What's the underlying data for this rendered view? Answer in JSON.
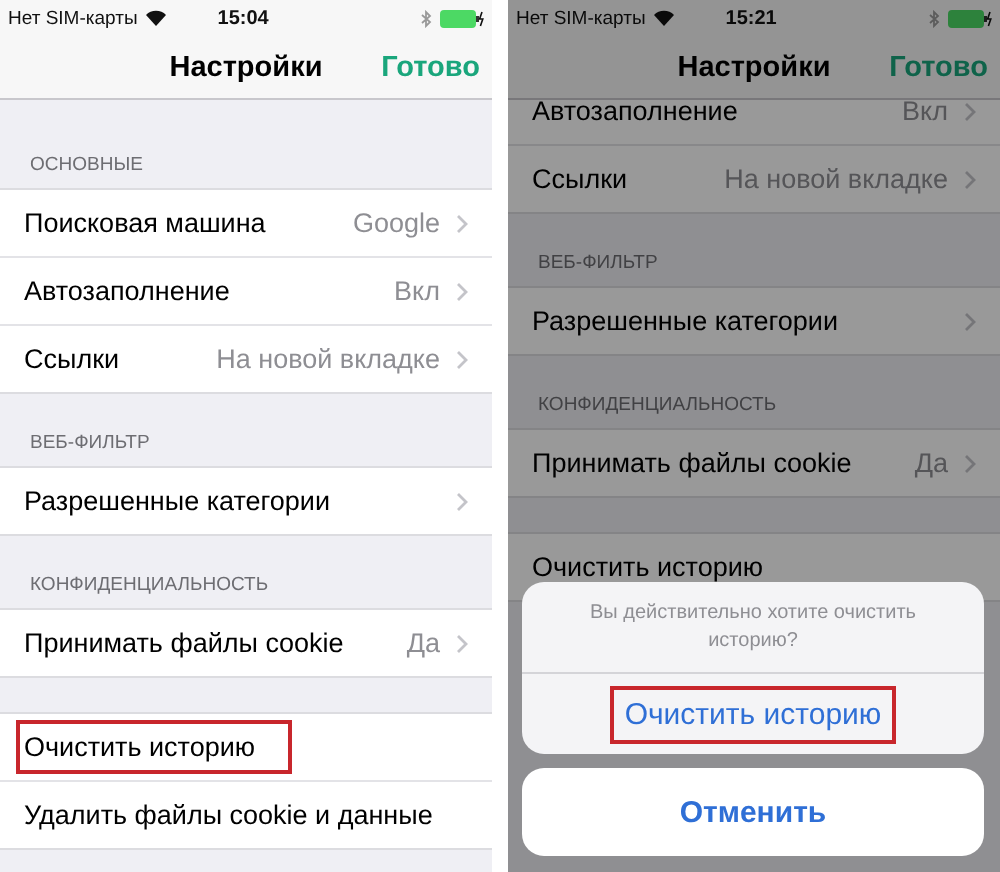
{
  "screens": [
    {
      "status_bar": {
        "carrier": "Нет SIM-карты",
        "time": "15:04"
      },
      "nav": {
        "title": "Настройки",
        "done": "Готово"
      },
      "scrolled": false,
      "dimmed": false,
      "sections": [
        {
          "header": "ОСНОВНЫЕ",
          "rows": [
            {
              "label": "Поисковая машина",
              "value": "Google",
              "chevron": true,
              "highlighted": false
            },
            {
              "label": "Автозаполнение",
              "value": "Вкл",
              "chevron": true,
              "highlighted": false
            },
            {
              "label": "Ссылки",
              "value": "На новой вкладке",
              "chevron": true,
              "highlighted": false
            }
          ]
        },
        {
          "header": "ВЕБ-ФИЛЬТР",
          "rows": [
            {
              "label": "Разрешенные категории",
              "chevron": true,
              "highlighted": false
            }
          ]
        },
        {
          "header": "КОНФИДЕНЦИАЛЬНОСТЬ",
          "rows": [
            {
              "label": "Принимать файлы cookie",
              "value": "Да",
              "chevron": true,
              "highlighted": false
            }
          ]
        },
        {
          "rows": [
            {
              "label": "Очистить историю",
              "chevron": false,
              "highlighted": true
            },
            {
              "label": "Удалить файлы cookie и данные",
              "chevron": false,
              "highlighted": false
            }
          ]
        }
      ]
    },
    {
      "status_bar": {
        "carrier": "Нет SIM-карты",
        "time": "15:21"
      },
      "nav": {
        "title": "Настройки",
        "done": "Готово"
      },
      "scrolled": true,
      "dimmed": true,
      "sections": [
        {
          "rows": [
            {
              "label": "Автозаполнение",
              "value": "Вкл",
              "chevron": true,
              "highlighted": false
            },
            {
              "label": "Ссылки",
              "value": "На новой вкладке",
              "chevron": true,
              "highlighted": false
            }
          ]
        },
        {
          "header": "ВЕБ-ФИЛЬТР",
          "rows": [
            {
              "label": "Разрешенные категории",
              "chevron": true,
              "highlighted": false
            }
          ]
        },
        {
          "header": "КОНФИДЕНЦИАЛЬНОСТЬ",
          "rows": [
            {
              "label": "Принимать файлы cookie",
              "value": "Да",
              "chevron": true,
              "highlighted": false
            }
          ]
        },
        {
          "rows": [
            {
              "label": "Очистить историю",
              "chevron": false,
              "highlighted": false
            }
          ]
        }
      ],
      "action_sheet": {
        "message": "Вы действительно хотите очистить историю?",
        "actions": [
          {
            "label": "Очистить историю",
            "highlighted": true
          }
        ],
        "cancel": "Отменить"
      }
    }
  ]
}
